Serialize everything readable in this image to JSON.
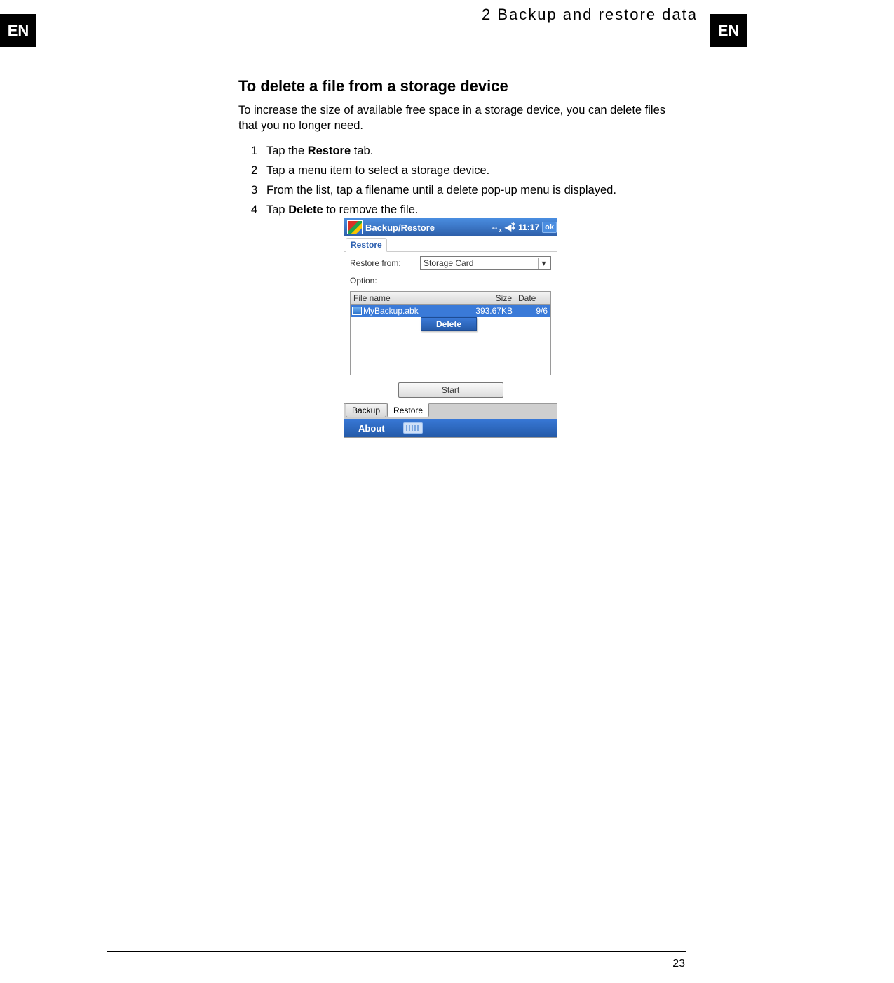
{
  "page": {
    "lang_badge": "EN",
    "chapter_header": "2 Backup and restore data",
    "page_number": "23"
  },
  "section": {
    "title": "To delete a file from a storage device",
    "intro": "To increase the size of available free space in a storage device, you can delete files that you no longer need.",
    "steps": [
      {
        "num": "1",
        "pre": "Tap the ",
        "bold": "Restore",
        "post": " tab."
      },
      {
        "num": "2",
        "pre": "Tap a menu item to select a storage device.",
        "bold": "",
        "post": ""
      },
      {
        "num": "3",
        "pre": "From the list, tap a filename until a delete pop-up menu is displayed.",
        "bold": "",
        "post": ""
      },
      {
        "num": "4",
        "pre": "Tap ",
        "bold": "Delete",
        "post": " to remove the file."
      }
    ]
  },
  "device": {
    "titlebar": {
      "app_title": "Backup/Restore",
      "time": "11:17",
      "ok": "ok"
    },
    "active_subtab": "Restore",
    "restore_from_label": "Restore from:",
    "restore_from_value": "Storage Card",
    "option_label": "Option:",
    "table": {
      "headers": {
        "file": "File name",
        "size": "Size",
        "date": "Date"
      },
      "row": {
        "file_name": "MyBackup.abk",
        "size": "393.67KB",
        "date": "9/6"
      },
      "popup": "Delete"
    },
    "start_button": "Start",
    "bottom_tabs": {
      "backup": "Backup",
      "restore": "Restore"
    },
    "menubar": {
      "about": "About"
    }
  }
}
